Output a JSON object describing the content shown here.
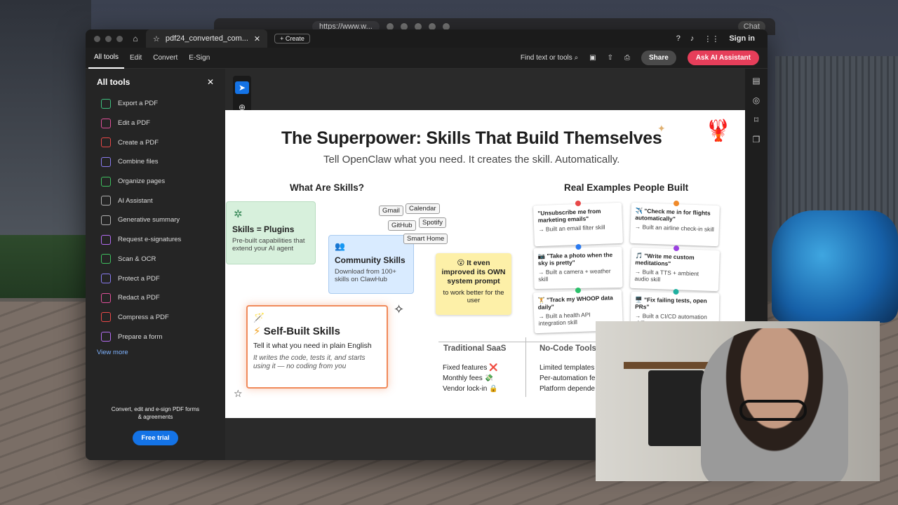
{
  "browser": {
    "url": "https://www.w...",
    "chat_label": "Chat"
  },
  "window": {
    "tab_title": "pdf24_converted_com...",
    "create_label": "Create",
    "signin_label": "Sign in"
  },
  "menubar": {
    "items": [
      "All tools",
      "Edit",
      "Convert",
      "E-Sign"
    ],
    "find_label": "Find text or tools",
    "share_label": "Share",
    "ai_label": "Ask AI Assistant"
  },
  "sidebar": {
    "title": "All tools",
    "items": [
      {
        "label": "Export a PDF",
        "color": "#3fbf7f",
        "icon": "export-icon"
      },
      {
        "label": "Edit a PDF",
        "color": "#e0509a",
        "icon": "edit-icon"
      },
      {
        "label": "Create a PDF",
        "color": "#e84848",
        "icon": "create-icon"
      },
      {
        "label": "Combine files",
        "color": "#8a7cf0",
        "icon": "combine-icon"
      },
      {
        "label": "Organize pages",
        "color": "#3fbf5f",
        "icon": "organize-icon"
      },
      {
        "label": "AI Assistant",
        "color": "#b0b0b0",
        "icon": "ai-icon"
      },
      {
        "label": "Generative summary",
        "color": "#b0b0b0",
        "icon": "summary-icon"
      },
      {
        "label": "Request e-signatures",
        "color": "#b36cf0",
        "icon": "signature-icon"
      },
      {
        "label": "Scan & OCR",
        "color": "#3fbf5f",
        "icon": "scan-icon"
      },
      {
        "label": "Protect a PDF",
        "color": "#8a7cf0",
        "icon": "protect-icon"
      },
      {
        "label": "Redact a PDF",
        "color": "#e0509a",
        "icon": "redact-icon"
      },
      {
        "label": "Compress a PDF",
        "color": "#e84848",
        "icon": "compress-icon"
      },
      {
        "label": "Prepare a form",
        "color": "#b36cf0",
        "icon": "form-icon"
      }
    ],
    "view_more": "View more",
    "promo": "Convert, edit and e-sign PDF forms & agreements",
    "free_trial": "Free trial"
  },
  "slide": {
    "title": "The Superpower: Skills That Build Themselves",
    "subtitle": "Tell OpenClaw what you need. It creates the skill. Automatically.",
    "left_heading": "What Are Skills?",
    "right_heading": "Real Examples People Built",
    "plugins": {
      "title": "Skills = Plugins",
      "body": "Pre-built capabilities that extend your AI agent"
    },
    "community": {
      "title": "Community Skills",
      "body": "Download from 100+ skills on ClawHub"
    },
    "tags": [
      "Gmail",
      "Calendar",
      "GitHub",
      "Spotify",
      "Smart Home"
    ],
    "selfbuilt": {
      "title": "Self-Built Skills",
      "line1": "Tell it what you need in plain English",
      "line2": "It writes the code, tests it, and starts using it — no coding from you"
    },
    "sticky": {
      "line1": "😮 It even improved its OWN system prompt",
      "line2": "to work better for the user"
    },
    "examples": [
      {
        "quote": "\"Unsubscribe me from marketing emails\"",
        "result": "→ Built an email filter skill",
        "pin": "#e84848"
      },
      {
        "quote": "✈️ \"Check me in for flights automatically\"",
        "result": "→ Built an airline check-in skill",
        "pin": "#f08a2a"
      },
      {
        "quote": "📷 \"Take a photo when the sky is pretty\"",
        "result": "→ Built a camera + weather skill",
        "pin": "#2a7af0"
      },
      {
        "quote": "🎵 \"Write me custom meditations\"",
        "result": "→ Built a TTS + ambient audio skill",
        "pin": "#9a40e0"
      },
      {
        "quote": "🏋️ \"Track my WHOOP data daily\"",
        "result": "→ Built a health API integration skill",
        "pin": "#2ac06a"
      },
      {
        "quote": "🖥️ \"Fix failing tests, open PRs\"",
        "result": "→ Built a CI/CD automation skill",
        "pin": "#20b0a0"
      }
    ],
    "table": {
      "col1": "Traditional SaaS",
      "col2": "No-Code Tools",
      "rows1": [
        "Fixed features ❌",
        "Monthly fees 💸",
        "Vendor lock-in 🔒"
      ],
      "rows2": [
        "Limited templates",
        "Per-automation fe",
        "Platform depende"
      ]
    }
  }
}
